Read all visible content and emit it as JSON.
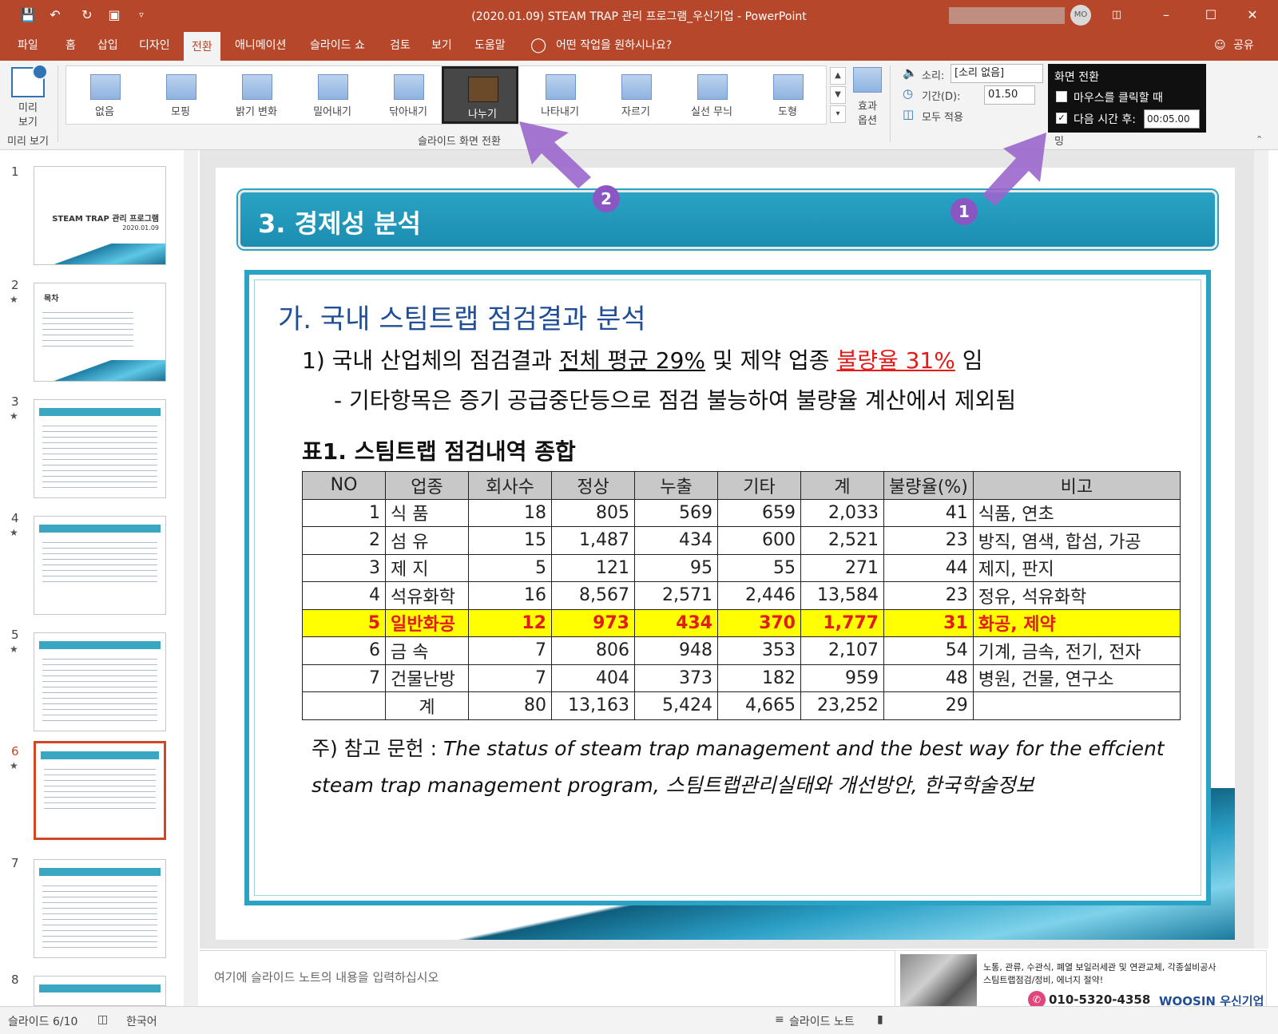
{
  "window": {
    "title": "(2020.01.09) STEAM TRAP 관리 프로그램_우신기업  -  PowerPoint",
    "avatar": "MO",
    "qat_icons": [
      "save-icon",
      "undo-icon",
      "redo-icon",
      "present-icon",
      "customize-icon"
    ]
  },
  "menu": {
    "tabs": [
      "파일",
      "홈",
      "삽입",
      "디자인",
      "전환",
      "애니메이션",
      "슬라이드 쇼",
      "검토",
      "보기",
      "도움말"
    ],
    "active": "전환",
    "tell_me": "어떤 작업을 원하시나요?",
    "share": "공유"
  },
  "ribbon": {
    "preview_label_1": "미리",
    "preview_label_2": "보기",
    "preview_group": "미리 보기",
    "transitions": [
      "없음",
      "모핑",
      "밝기 변화",
      "밀어내기",
      "닦아내기",
      "나누기",
      "나타내기",
      "자르기",
      "실선 무늬",
      "도형"
    ],
    "selected_transition": "나누기",
    "effect_label_1": "효과",
    "effect_label_2": "옵션",
    "transition_group": "슬라이드 화면 전환",
    "sound_label": "소리:",
    "sound_value": "[소리 없음]",
    "duration_label": "기간(D):",
    "duration_value": "01.50",
    "apply_all": "모두 적용",
    "timing_header": "화면 전환",
    "on_click": "마우스를 클릭할 때",
    "on_click_checked": false,
    "after_label": "다음 시간 후:",
    "after_checked": true,
    "after_value": "00:05.00",
    "timing_group_tail": "밍"
  },
  "thumbnails": [
    {
      "num": "1",
      "star": "",
      "title": "STEAM TRAP 관리 프로그램",
      "date": "2020.01.09"
    },
    {
      "num": "2",
      "star": "★",
      "title": "목차"
    },
    {
      "num": "3",
      "star": "★"
    },
    {
      "num": "4",
      "star": "★"
    },
    {
      "num": "5",
      "star": "★"
    },
    {
      "num": "6",
      "star": "★"
    },
    {
      "num": "7",
      "star": ""
    },
    {
      "num": "8",
      "star": ""
    }
  ],
  "slide": {
    "header": "3. 경제성 분석",
    "subtitle": "가. 국내 스팀트랩 점검결과 분석",
    "line1_a": "1) 국내 산업체의 점검결과 ",
    "line1_b": "전체 평균 29%",
    "line1_c": " 및 제약 업종 ",
    "line1_d": "불량율 31%",
    "line1_e": " 임",
    "line2": "- 기타항목은 증기 공급중단등으로 점검 불능하여 불량율 계산에서 제외됨",
    "table_title": "표1. 스팀트랩 점검내역 종합",
    "columns": [
      "NO",
      "업종",
      "회사수",
      "정상",
      "누출",
      "기타",
      "계",
      "불량율(%)",
      "비고"
    ],
    "rows": [
      [
        "1",
        "식      품",
        "18",
        "805",
        "569",
        "659",
        "2,033",
        "41",
        "식품, 연초"
      ],
      [
        "2",
        "섬      유",
        "15",
        "1,487",
        "434",
        "600",
        "2,521",
        "23",
        "방직, 염색, 합섬, 가공"
      ],
      [
        "3",
        "제      지",
        "5",
        "121",
        "95",
        "55",
        "271",
        "44",
        "제지, 판지"
      ],
      [
        "4",
        "석유화학",
        "16",
        "8,567",
        "2,571",
        "2,446",
        "13,584",
        "23",
        "정유, 석유화학"
      ],
      [
        "5",
        "일반화공",
        "12",
        "973",
        "434",
        "370",
        "1,777",
        "31",
        "화공, 제약"
      ],
      [
        "6",
        "금      속",
        "7",
        "806",
        "948",
        "353",
        "2,107",
        "54",
        "기계, 금속, 전기, 전자"
      ],
      [
        "7",
        "건물난방",
        "7",
        "404",
        "373",
        "182",
        "959",
        "48",
        "병원, 건물, 연구소"
      ],
      [
        "",
        "계",
        "80",
        "13,163",
        "5,424",
        "4,665",
        "23,252",
        "29",
        ""
      ]
    ],
    "highlight_row": 4,
    "note_prefix": "주) 참고 문헌 : ",
    "note_italic": "The status of steam trap management and the best way for the effcient",
    "note_line2": "steam trap management program, 스팀트랩관리실태와 개선방안, 한국학술정보"
  },
  "callouts": [
    "1",
    "2"
  ],
  "notes_placeholder": "여기에 슬라이드 노트의 내용을 입력하십시오",
  "ad": {
    "line1": "노통, 관류, 수관식, 폐열 보일러세관 및 연관교체, 각종설비공사",
    "line2": "스팀트랩점검/정비, 에너지 절약!",
    "phone": "010-5320-4358",
    "company": "WOOSIN 우신기업"
  },
  "status": {
    "slide": "슬라이드 6/10",
    "language": "한국어",
    "notes": "슬라이드 노트"
  },
  "colors": {
    "accent": "#b7472a",
    "slide_teal": "#2aa3c4",
    "callout": "#8a56c2",
    "highlight": "#ffff00"
  }
}
